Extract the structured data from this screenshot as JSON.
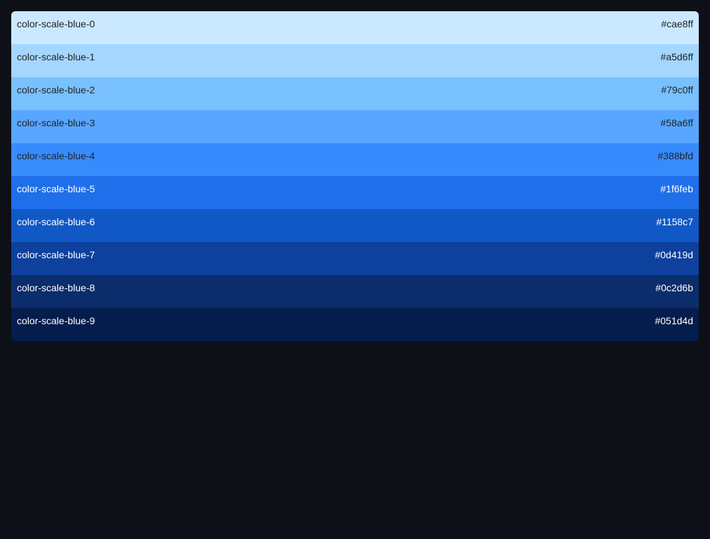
{
  "palette": {
    "swatches": [
      {
        "name": "color-scale-blue-0",
        "hex": "#cae8ff",
        "text_color": "#1f2328"
      },
      {
        "name": "color-scale-blue-1",
        "hex": "#a5d6ff",
        "text_color": "#1f2328"
      },
      {
        "name": "color-scale-blue-2",
        "hex": "#79c0ff",
        "text_color": "#1f2328"
      },
      {
        "name": "color-scale-blue-3",
        "hex": "#58a6ff",
        "text_color": "#1f2328"
      },
      {
        "name": "color-scale-blue-4",
        "hex": "#388bfd",
        "text_color": "#1f2328"
      },
      {
        "name": "color-scale-blue-5",
        "hex": "#1f6feb",
        "text_color": "#ffffff"
      },
      {
        "name": "color-scale-blue-6",
        "hex": "#1158c7",
        "text_color": "#ffffff"
      },
      {
        "name": "color-scale-blue-7",
        "hex": "#0d419d",
        "text_color": "#ffffff"
      },
      {
        "name": "color-scale-blue-8",
        "hex": "#0c2d6b",
        "text_color": "#ffffff"
      },
      {
        "name": "color-scale-blue-9",
        "hex": "#051d4d",
        "text_color": "#ffffff"
      }
    ]
  }
}
